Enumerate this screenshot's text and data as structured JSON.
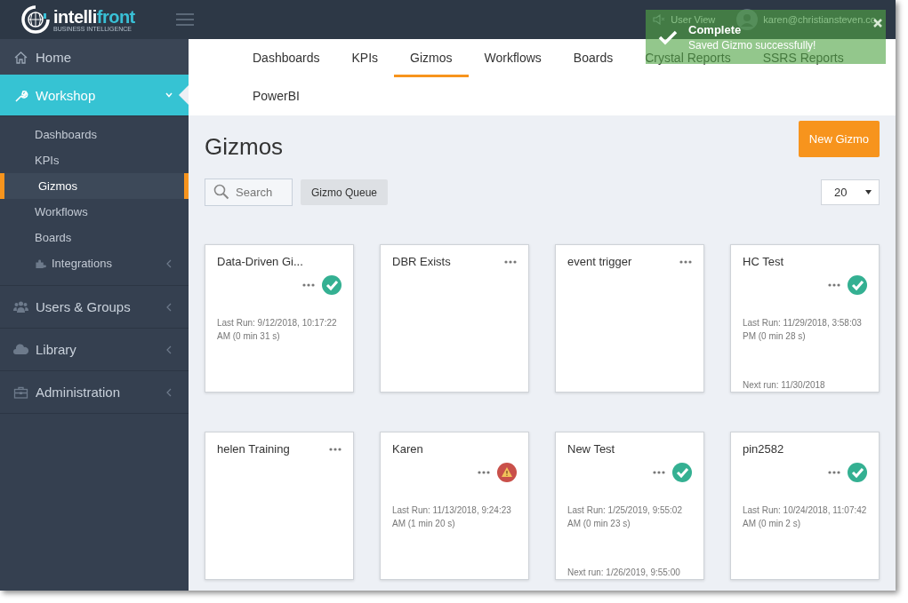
{
  "header": {
    "logo": "intelli**front**",
    "tagline": "BUSINESS INTELLIGENCE",
    "user_view": "User View",
    "email": "karen@christiansteven.co"
  },
  "toast": {
    "title": "Complete",
    "message": "Saved Gizmo successfully!"
  },
  "sidebar": {
    "items": [
      {
        "label": "Home",
        "selected": false
      },
      {
        "label": "Workshop",
        "selected": true,
        "expanded": true,
        "children": [
          {
            "label": "Dashboards",
            "selected": false
          },
          {
            "label": "KPIs",
            "selected": false
          },
          {
            "label": "Gizmos",
            "selected": true
          },
          {
            "label": "Workflows",
            "selected": false
          },
          {
            "label": "Boards",
            "selected": false
          },
          {
            "label": "Integrations",
            "selected": false,
            "expanded": false
          }
        ]
      },
      {
        "label": "Users & Groups",
        "selected": false,
        "expanded": false
      },
      {
        "label": "Library",
        "selected": false,
        "expanded": false
      },
      {
        "label": "Administration",
        "selected": false,
        "expanded": false
      }
    ]
  },
  "tabs": [
    {
      "label": "Dashboards",
      "selected": false
    },
    {
      "label": "KPIs",
      "selected": false
    },
    {
      "label": "Gizmos",
      "selected": true
    },
    {
      "label": "Workflows",
      "selected": false
    },
    {
      "label": "Boards",
      "selected": false
    },
    {
      "label": "Crystal Reports",
      "selected": false
    },
    {
      "label": "SSRS Reports",
      "selected": false
    },
    {
      "label": "PowerBI",
      "selected": false
    }
  ],
  "page": {
    "title": "Gizmos",
    "new_button": "New Gizmo",
    "search": {
      "placeholder": "Search"
    },
    "queue_button": "Gizmo Queue",
    "page_size": "20"
  },
  "cards": [
    {
      "title": "Data-Driven Gi...",
      "kind": "ok",
      "last_run": "Last Run: 9/12/2018, 10:17:22 AM (0 min 31 s)"
    },
    {
      "title": "DBR Exists"
    },
    {
      "title": "event trigger"
    },
    {
      "title": "HC Test",
      "kind": "ok",
      "last_run": "Last Run: 11/29/2018, 3:58:03 PM (0 min 28 s)",
      "next_run": "Next run: 11/30/2018"
    },
    {
      "title": "helen Training"
    },
    {
      "title": "Karen",
      "kind": "warning",
      "last_run": "Last Run: 11/13/2018, 9:24:23 AM (1 min 20 s)"
    },
    {
      "title": "New Test",
      "kind": "ok",
      "last_run": "Last Run: 1/25/2019, 9:55:02 AM (0 min 23 s)",
      "next_run": "Next run: 1/26/2019, 9:55:00"
    },
    {
      "title": "pin2582",
      "kind": "ok",
      "last_run": "Last Run: 10/24/2018, 11:07:42 AM (0 min 2 s)"
    }
  ]
}
